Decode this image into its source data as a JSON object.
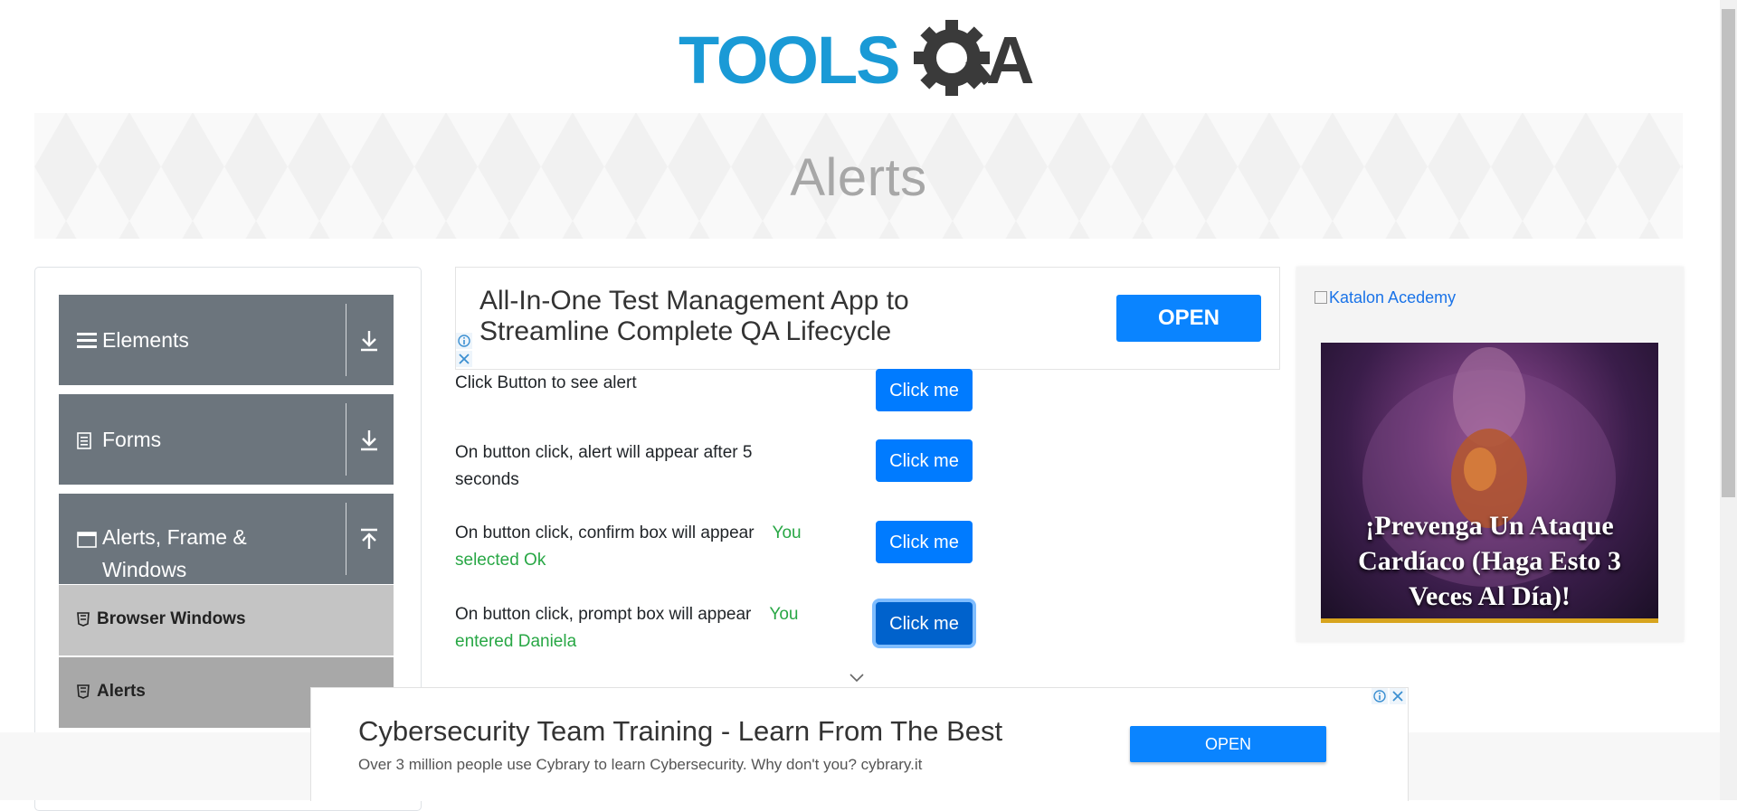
{
  "header": {
    "logo_text": "TOOLSQA"
  },
  "banner": {
    "title": "Alerts"
  },
  "sidebar": {
    "groups": [
      {
        "label": "Elements",
        "icon": "hamburger-icon",
        "arrow": "download-arrow-icon"
      },
      {
        "label": "Forms",
        "icon": "document-icon",
        "arrow": "download-arrow-icon"
      },
      {
        "label": "Alerts, Frame & Windows",
        "icon": "window-icon",
        "arrow": "upload-arrow-icon"
      }
    ],
    "items": [
      {
        "label": "Browser Windows"
      },
      {
        "label": "Alerts"
      }
    ]
  },
  "main_ad": {
    "text": "All-In-One Test Management App to Streamline Complete QA Lifecycle",
    "button": "OPEN"
  },
  "alerts": {
    "rows": [
      {
        "label": "Click Button to see alert",
        "result": "",
        "button": "Click me"
      },
      {
        "label": "On button click, alert will appear after 5 seconds",
        "result": "",
        "button": "Click me"
      },
      {
        "label": "On button click, confirm box will appear",
        "result": "You selected Ok",
        "button": "Click me"
      },
      {
        "label": "On button click, prompt box will appear",
        "result": "You entered Daniela",
        "button": "Click me"
      }
    ]
  },
  "right_ad": {
    "link_text": "Katalon Acedemy",
    "headline": "¡Prevenga Un Ataque Cardíaco (Haga Esto 3 Veces Al Día)!"
  },
  "bottom_ad": {
    "title": "Cybersecurity Team Training - Learn From The Best",
    "subtitle": "Over 3 million people use Cybrary to learn Cybersecurity. Why don't you? cybrary.it",
    "button": "OPEN"
  },
  "colors": {
    "accent": "#007bff",
    "sidebar_group": "#6c757d",
    "success": "#28a745",
    "logo_blue": "#1a9ad6",
    "logo_dark": "#3a3a3a"
  }
}
